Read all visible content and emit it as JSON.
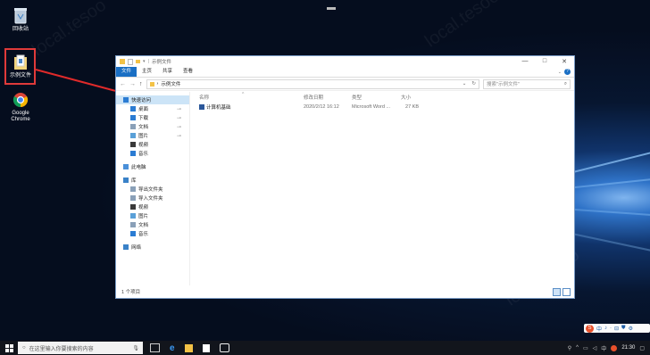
{
  "desktop": {
    "icons": [
      {
        "label": "回收站",
        "icon": "recycle-bin-icon"
      },
      {
        "label": "示例文件",
        "icon": "folder-icon"
      },
      {
        "label": "Google\nChrome",
        "icon": "chrome-icon"
      }
    ],
    "watermark": "local.tesoo"
  },
  "explorer": {
    "title": "示例文件",
    "window_controls": [
      "—",
      "□",
      "✕"
    ],
    "ribbon_tabs": [
      "文件",
      "主页",
      "共享",
      "查看"
    ],
    "help_icon": "?",
    "address": {
      "back": "←",
      "forward": "→",
      "up": "↑",
      "path_sep": "›",
      "path": "示例文件",
      "search_placeholder": "搜索\"示例文件\""
    },
    "nav_pane": {
      "items": [
        {
          "label": "快速访问",
          "icon": "star-icon",
          "color": "#2b7cd3",
          "sub": false,
          "active": true,
          "pin": false
        },
        {
          "label": "桌面",
          "icon": "desktop-icon",
          "color": "#2b7cd3",
          "sub": true,
          "active": false,
          "pin": true
        },
        {
          "label": "下载",
          "icon": "download-icon",
          "color": "#2b7cd3",
          "sub": true,
          "active": false,
          "pin": true
        },
        {
          "label": "文档",
          "icon": "documents-icon",
          "color": "#8aa0b8",
          "sub": true,
          "active": false,
          "pin": true
        },
        {
          "label": "图片",
          "icon": "pictures-icon",
          "color": "#5aa0d8",
          "sub": true,
          "active": false,
          "pin": true
        },
        {
          "label": "视频",
          "icon": "videos-icon",
          "color": "#3a3a3a",
          "sub": true,
          "active": false,
          "pin": false
        },
        {
          "label": "音乐",
          "icon": "music-icon",
          "color": "#2b7cd3",
          "sub": true,
          "active": false,
          "pin": false
        },
        {
          "label": "此电脑",
          "icon": "computer-icon",
          "color": "#4a90d9",
          "sub": false,
          "active": false,
          "pin": false
        },
        {
          "label": "库",
          "icon": "library-icon",
          "color": "#3a82c8",
          "sub": false,
          "active": false,
          "pin": false
        },
        {
          "label": "导出文件夹",
          "icon": "folder-icon",
          "color": "#8aa0b8",
          "sub": true,
          "active": false,
          "pin": false
        },
        {
          "label": "导入文件夹",
          "icon": "folder-icon",
          "color": "#8aa0b8",
          "sub": true,
          "active": false,
          "pin": false
        },
        {
          "label": "视频",
          "icon": "videos-icon",
          "color": "#3a3a3a",
          "sub": true,
          "active": false,
          "pin": false
        },
        {
          "label": "图片",
          "icon": "pictures-icon",
          "color": "#5aa0d8",
          "sub": true,
          "active": false,
          "pin": false
        },
        {
          "label": "文档",
          "icon": "documents-icon",
          "color": "#8aa0b8",
          "sub": true,
          "active": false,
          "pin": false
        },
        {
          "label": "音乐",
          "icon": "music-icon",
          "color": "#2b7cd3",
          "sub": true,
          "active": false,
          "pin": false
        },
        {
          "label": "网络",
          "icon": "network-icon",
          "color": "#3a82c8",
          "sub": false,
          "active": false,
          "pin": false
        }
      ],
      "pin_glyph": "⊸"
    },
    "columns": [
      "名称",
      "修改日期",
      "类型",
      "大小"
    ],
    "sort_glyph": "^",
    "files": [
      {
        "name": "计算机基础",
        "modified": "2020/2/12 16:12",
        "type": "Microsoft Word ...",
        "size": "27 KB",
        "icon": "word-doc-icon"
      }
    ],
    "status_text": "1 个项目"
  },
  "taskbar": {
    "search_placeholder": "在这里输入你要搜索的内容",
    "apps": [
      "mic-icon",
      "task-view-icon",
      "edge-icon",
      "store-icon",
      "shopping-bag-icon",
      "camera-icon"
    ],
    "time": "21:30",
    "ime_items": [
      "中",
      "♪",
      "·",
      "⊟",
      "⛊",
      "⚙"
    ]
  },
  "accent": "#1a6fc4"
}
